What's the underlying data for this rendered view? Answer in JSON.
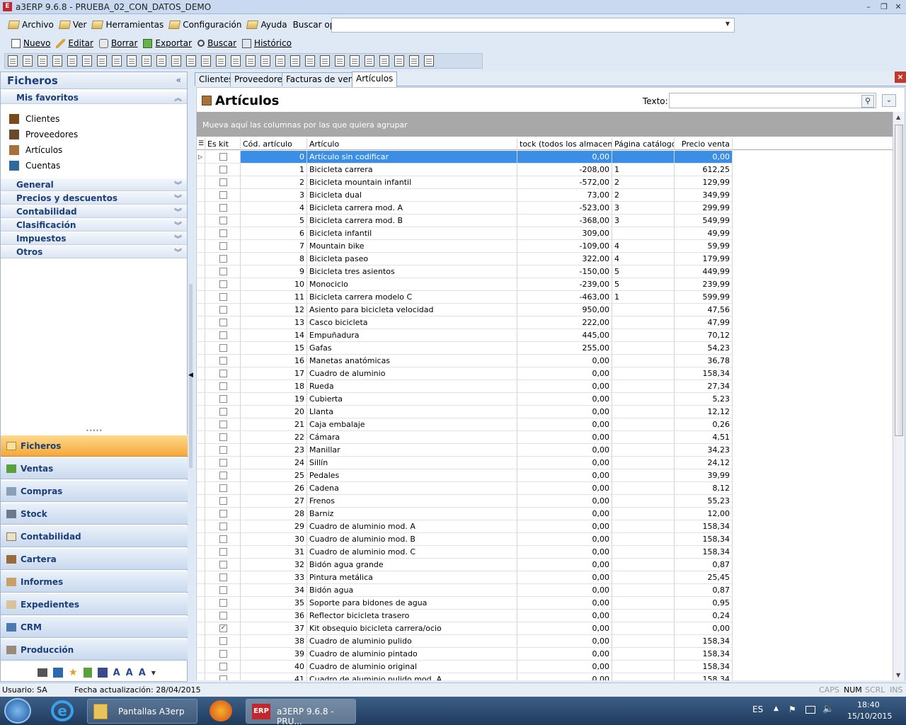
{
  "window": {
    "title": "a3ERP 9.6.8 - PRUEBA_02_CON_DATOS_DEMO",
    "app_icon": "E",
    "minimize": "–",
    "maximize": "❐",
    "close": "✕"
  },
  "menu": {
    "items": [
      "Archivo",
      "Ver",
      "Herramientas",
      "Configuración",
      "Ayuda"
    ],
    "search_label": "Buscar opción:"
  },
  "actions": [
    {
      "label": "Nuevo",
      "icon": "new-document-icon"
    },
    {
      "label": "Editar",
      "icon": "pencil-icon"
    },
    {
      "label": "Borrar",
      "icon": "eraser-icon"
    },
    {
      "label": "Exportar",
      "icon": "export-icon"
    },
    {
      "label": "Buscar",
      "icon": "search-icon"
    },
    {
      "label": "Histórico",
      "icon": "history-icon"
    }
  ],
  "sidebar": {
    "title": "Ficheros",
    "collapse_glyph": "«",
    "favorites_title": "Mis favoritos",
    "favorites": [
      {
        "label": "Clientes",
        "icon": "clients-icon",
        "color": "#7a4a1a"
      },
      {
        "label": "Proveedores",
        "icon": "suppliers-icon",
        "color": "#6b4a2a"
      },
      {
        "label": "Artículos",
        "icon": "box-icon",
        "color": "#a8703a"
      },
      {
        "label": "Cuentas",
        "icon": "accounts-icon",
        "color": "#2c6aa0"
      }
    ],
    "sections": [
      "General",
      "Precios y descuentos",
      "Contabilidad",
      "Clasificación",
      "Impuestos",
      "Otros"
    ],
    "nav": [
      "Ficheros",
      "Ventas",
      "Compras",
      "Stock",
      "Contabilidad",
      "Cartera",
      "Informes",
      "Expedientes",
      "CRM",
      "Producción"
    ]
  },
  "tabs": [
    "Clientes",
    "Proveedores",
    "Facturas de venta",
    "Artículos"
  ],
  "main": {
    "title": "Artículos",
    "texto_label": "Texto:",
    "group_hint": "Mueva aquí las columnas por las que quiera agrupar"
  },
  "grid": {
    "columns": [
      "Es kit",
      "Cód. artículo",
      "Artículo",
      "tock (todos los almacenes)",
      "Página catálogo",
      "Precio venta"
    ],
    "rows": [
      {
        "kit": false,
        "code": "0",
        "name": "Artículo sin codificar",
        "stock": "0,00",
        "page": "",
        "price": "0,00"
      },
      {
        "kit": false,
        "code": "1",
        "name": "Bicicleta carrera",
        "stock": "-208,00",
        "page": "1",
        "price": "612,25"
      },
      {
        "kit": false,
        "code": "2",
        "name": "Bicicleta mountain infantil",
        "stock": "-572,00",
        "page": "2",
        "price": "129,99"
      },
      {
        "kit": false,
        "code": "3",
        "name": "Bicicleta dual",
        "stock": "73,00",
        "page": "2",
        "price": "349,99"
      },
      {
        "kit": false,
        "code": "4",
        "name": "Bicicleta carrera mod. A",
        "stock": "-523,00",
        "page": "3",
        "price": "299,99"
      },
      {
        "kit": false,
        "code": "5",
        "name": "Bicicleta carrera mod. B",
        "stock": "-368,00",
        "page": "3",
        "price": "549,99"
      },
      {
        "kit": false,
        "code": "6",
        "name": "Bicicleta infantil",
        "stock": "309,00",
        "page": "",
        "price": "49,99"
      },
      {
        "kit": false,
        "code": "7",
        "name": "Mountain bike",
        "stock": "-109,00",
        "page": "4",
        "price": "59,99"
      },
      {
        "kit": false,
        "code": "8",
        "name": "Bicicleta paseo",
        "stock": "322,00",
        "page": "4",
        "price": "179,99"
      },
      {
        "kit": false,
        "code": "9",
        "name": "Bicicleta tres asientos",
        "stock": "-150,00",
        "page": "5",
        "price": "449,99"
      },
      {
        "kit": false,
        "code": "10",
        "name": "Monociclo",
        "stock": "-239,00",
        "page": "5",
        "price": "239,99"
      },
      {
        "kit": false,
        "code": "11",
        "name": "Bicicleta carrera modelo C",
        "stock": "-463,00",
        "page": "1",
        "price": "599,99"
      },
      {
        "kit": false,
        "code": "12",
        "name": "Asiento para bicicleta velocidad",
        "stock": "950,00",
        "page": "",
        "price": "47,56"
      },
      {
        "kit": false,
        "code": "13",
        "name": "Casco bicicleta",
        "stock": "222,00",
        "page": "",
        "price": "47,99"
      },
      {
        "kit": false,
        "code": "14",
        "name": "Empuñadura",
        "stock": "445,00",
        "page": "",
        "price": "70,12"
      },
      {
        "kit": false,
        "code": "15",
        "name": "Gafas",
        "stock": "255,00",
        "page": "",
        "price": "54,23"
      },
      {
        "kit": false,
        "code": "16",
        "name": "Manetas anatómicas",
        "stock": "0,00",
        "page": "",
        "price": "36,78"
      },
      {
        "kit": false,
        "code": "17",
        "name": "Cuadro de aluminio",
        "stock": "0,00",
        "page": "",
        "price": "158,34"
      },
      {
        "kit": false,
        "code": "18",
        "name": "Rueda",
        "stock": "0,00",
        "page": "",
        "price": "27,34"
      },
      {
        "kit": false,
        "code": "19",
        "name": "Cubierta",
        "stock": "0,00",
        "page": "",
        "price": "5,23"
      },
      {
        "kit": false,
        "code": "20",
        "name": "Llanta",
        "stock": "0,00",
        "page": "",
        "price": "12,12"
      },
      {
        "kit": false,
        "code": "21",
        "name": "Caja embalaje",
        "stock": "0,00",
        "page": "",
        "price": "0,26"
      },
      {
        "kit": false,
        "code": "22",
        "name": "Cámara",
        "stock": "0,00",
        "page": "",
        "price": "4,51"
      },
      {
        "kit": false,
        "code": "23",
        "name": "Manillar",
        "stock": "0,00",
        "page": "",
        "price": "34,23"
      },
      {
        "kit": false,
        "code": "24",
        "name": "Sillín",
        "stock": "0,00",
        "page": "",
        "price": "24,12"
      },
      {
        "kit": false,
        "code": "25",
        "name": "Pedales",
        "stock": "0,00",
        "page": "",
        "price": "39,99"
      },
      {
        "kit": false,
        "code": "26",
        "name": "Cadena",
        "stock": "0,00",
        "page": "",
        "price": "8,12"
      },
      {
        "kit": false,
        "code": "27",
        "name": "Frenos",
        "stock": "0,00",
        "page": "",
        "price": "55,23"
      },
      {
        "kit": false,
        "code": "28",
        "name": "Barniz",
        "stock": "0,00",
        "page": "",
        "price": "12,00"
      },
      {
        "kit": false,
        "code": "29",
        "name": "Cuadro de aluminio mod. A",
        "stock": "0,00",
        "page": "",
        "price": "158,34"
      },
      {
        "kit": false,
        "code": "30",
        "name": "Cuadro de aluminio mod. B",
        "stock": "0,00",
        "page": "",
        "price": "158,34"
      },
      {
        "kit": false,
        "code": "31",
        "name": "Cuadro de aluminio mod. C",
        "stock": "0,00",
        "page": "",
        "price": "158,34"
      },
      {
        "kit": false,
        "code": "32",
        "name": "Bidón agua grande",
        "stock": "0,00",
        "page": "",
        "price": "0,87"
      },
      {
        "kit": false,
        "code": "33",
        "name": "Pintura metálica",
        "stock": "0,00",
        "page": "",
        "price": "25,45"
      },
      {
        "kit": false,
        "code": "34",
        "name": "Bidón agua",
        "stock": "0,00",
        "page": "",
        "price": "0,87"
      },
      {
        "kit": false,
        "code": "35",
        "name": "Soporte para bidones de agua",
        "stock": "0,00",
        "page": "",
        "price": "0,95"
      },
      {
        "kit": false,
        "code": "36",
        "name": "Reflector bicicleta trasero",
        "stock": "0,00",
        "page": "",
        "price": "0,24"
      },
      {
        "kit": true,
        "code": "37",
        "name": "Kit obsequio bicicleta carrera/ocio",
        "stock": "0,00",
        "page": "",
        "price": "0,00"
      },
      {
        "kit": false,
        "code": "38",
        "name": "Cuadro de aluminio pulido",
        "stock": "0,00",
        "page": "",
        "price": "158,34"
      },
      {
        "kit": false,
        "code": "39",
        "name": "Cuadro de aluminio pintado",
        "stock": "0,00",
        "page": "",
        "price": "158,34"
      },
      {
        "kit": false,
        "code": "40",
        "name": "Cuadro de aluminio original",
        "stock": "0,00",
        "page": "",
        "price": "158,34"
      },
      {
        "kit": false,
        "code": "41",
        "name": "Cuadro de aluminio pulido mod. A",
        "stock": "0,00",
        "page": "",
        "price": "158,34"
      }
    ]
  },
  "status": {
    "user": "Usuario: SA",
    "date": "Fecha actualización: 28/04/2015",
    "indicators": [
      "CAPS",
      "NUM",
      "SCRL",
      "INS"
    ]
  },
  "taskbar": {
    "apps": [
      {
        "label": "Pantallas A3erp",
        "icon": "folder-icon"
      },
      {
        "label": "a3ERP 9.6.8 - PRU...",
        "icon": "erp-icon"
      }
    ],
    "lang": "ES",
    "time": "18:40",
    "date": "15/10/2015"
  }
}
